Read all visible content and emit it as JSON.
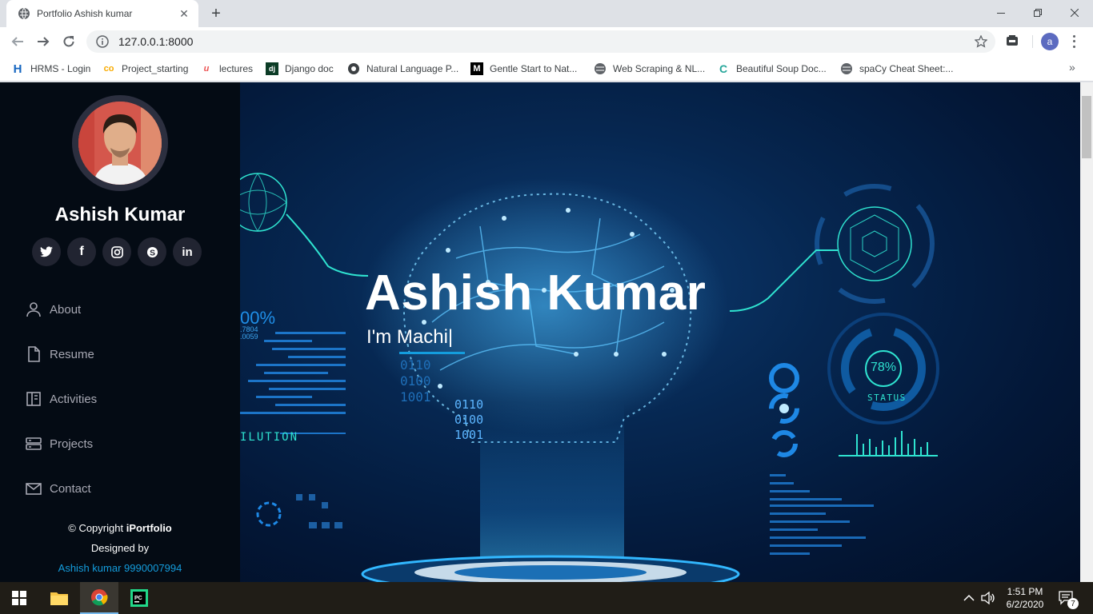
{
  "browser": {
    "tab_title": "Portfolio Ashish kumar",
    "url": "127.0.0.1:8000",
    "profile_initial": "a",
    "bookmarks": [
      {
        "label": "HRMS - Login",
        "icon": "H"
      },
      {
        "label": "Project_starting",
        "icon": "co"
      },
      {
        "label": "lectures",
        "icon": "u"
      },
      {
        "label": "Django doc",
        "icon": "dj"
      },
      {
        "label": "Natural Language P...",
        "icon": "globe"
      },
      {
        "label": "Gentle Start to Nat...",
        "icon": "M"
      },
      {
        "label": "Web Scraping & NL...",
        "icon": "globe"
      },
      {
        "label": "Beautiful Soup Doc...",
        "icon": "C"
      },
      {
        "label": "spaCy Cheat Sheet:...",
        "icon": "globe"
      }
    ],
    "bookmarks_more": "»"
  },
  "sidebar": {
    "name": "Ashish Kumar",
    "socials": [
      {
        "name": "twitter",
        "glyph": "t"
      },
      {
        "name": "facebook",
        "glyph": "f"
      },
      {
        "name": "instagram",
        "glyph": "ig"
      },
      {
        "name": "skype",
        "glyph": "S"
      },
      {
        "name": "linkedin",
        "glyph": "in"
      }
    ],
    "nav": [
      {
        "label": "About",
        "icon": "user-icon"
      },
      {
        "label": "Resume",
        "icon": "file-icon"
      },
      {
        "label": "Activities",
        "icon": "book-icon"
      },
      {
        "label": "Projects",
        "icon": "server-icon"
      },
      {
        "label": "Contact",
        "icon": "envelope-icon"
      }
    ],
    "footer": {
      "copyright_prefix": "© Copyright ",
      "brand": "iPortfolio",
      "designed_by": "Designed by",
      "credit": "Ashish kumar 9990007994"
    }
  },
  "hero": {
    "title": "Ashish Kumar",
    "subtitle": "I'm Machi|",
    "overlay_texts": {
      "percent": "00%",
      "small_1": ".7804",
      "small_2": ".0059",
      "label_left": "ILUTION",
      "binary_1": "0110",
      "binary_2": "0100",
      "binary_3": "1001",
      "binary_4": "0110",
      "binary_5": "0100",
      "binary_6": "1001",
      "status_value": "78%",
      "status_label": "STATUS"
    }
  },
  "taskbar": {
    "time": "1:51 PM",
    "date": "6/2/2020",
    "notifications": "7"
  },
  "colors": {
    "accent": "#149ddd",
    "sidebar_bg": "#040b14",
    "hero_bg": "#031737"
  }
}
